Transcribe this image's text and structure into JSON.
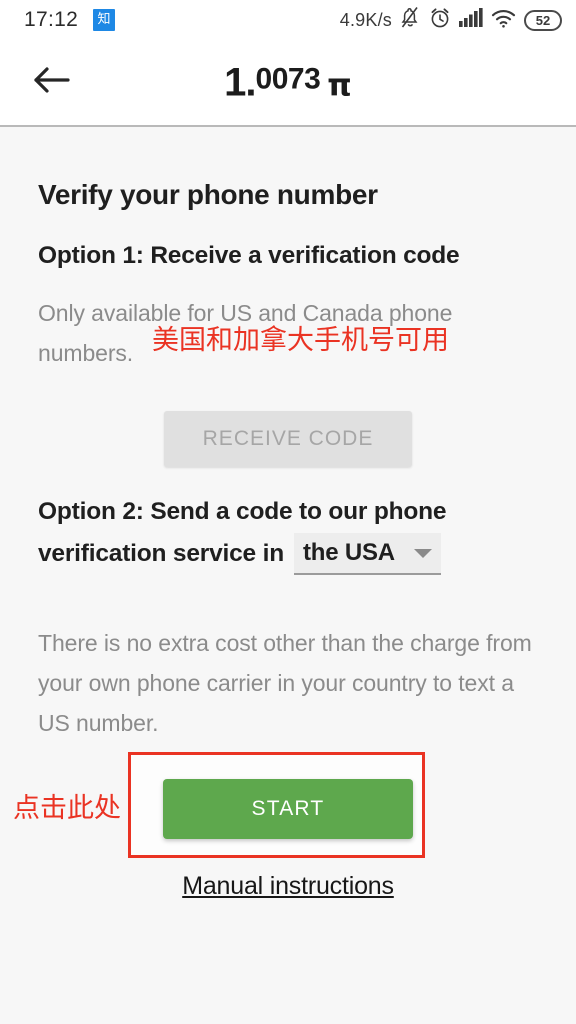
{
  "statusbar": {
    "time": "17:12",
    "app_badge": "知",
    "network_speed": "4.9K/s",
    "icons": [
      "bell-muted-icon",
      "alarm-clock-icon",
      "signal-bars-icon",
      "wifi-icon"
    ],
    "battery_level": "52"
  },
  "appbar": {
    "back_icon": "back-arrow-icon",
    "title_integer": "1.",
    "title_decimals": "0073",
    "title_symbol": "π"
  },
  "main": {
    "page_title": "Verify your phone number",
    "option1": {
      "heading": "Option 1: Receive a verification code",
      "note": "Only available for US and Canada phone numbers.",
      "annotation_cn": "美国和加拿大手机号可用",
      "button_label": "RECEIVE CODE"
    },
    "option2": {
      "heading_line1": "Option 2: Send a code to our phone",
      "heading_line2": "verification service in",
      "country_select": {
        "value": "the USA",
        "caret_icon": "chevron-down-icon"
      },
      "note": "There is no extra cost other than the charge from your own phone carrier in your country to text a US number.",
      "button_label": "START",
      "annotation_cn": "点击此处"
    },
    "manual_link": "Manual instructions"
  },
  "colors": {
    "accent_green": "#5ea84d",
    "annotation_red": "#ea3323",
    "app_badge_blue": "#1e88e5",
    "page_background": "#f7f7f7"
  }
}
